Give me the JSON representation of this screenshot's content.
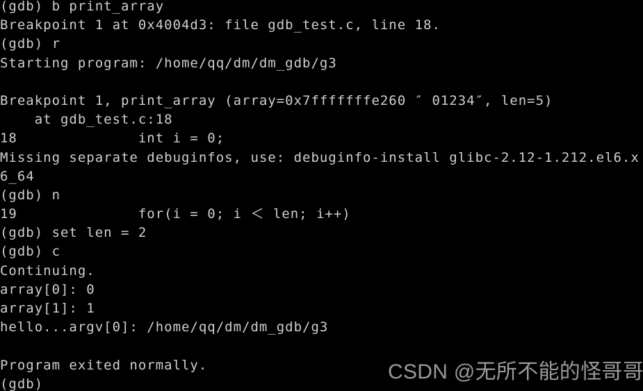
{
  "terminal": {
    "background_color": "#000000",
    "foreground_color": "#cfcfcf",
    "prompt": "(gdb)",
    "lines": [
      "(gdb) b print_array",
      "Breakpoint 1 at 0x4004d3: file gdb_test.c, line 18.",
      "(gdb) r",
      "Starting program: /home/qq/dm/dm_gdb/g3",
      "",
      "Breakpoint 1, print_array (array=0x7fffffffe260 ″ 01234″, len=5)",
      "    at gdb_test.c:18",
      "18              int i = 0;",
      "Missing separate debuginfos, use: debuginfo-install glibc-2.12-1.212.el6.x",
      "6_64",
      "(gdb) n",
      "19              for(i = 0; i ＜ len; i++)",
      "(gdb) set len = 2",
      "(gdb) c",
      "Continuing.",
      "array[0]: 0",
      "array[1]: 1",
      "hello...argv[0]: /home/qq/dm/dm_gdb/g3",
      "",
      "Program exited normally.",
      "(gdb)"
    ]
  },
  "watermark": {
    "text": "CSDN @无所不能的怪哥哥",
    "color": "#9a9a9a"
  }
}
